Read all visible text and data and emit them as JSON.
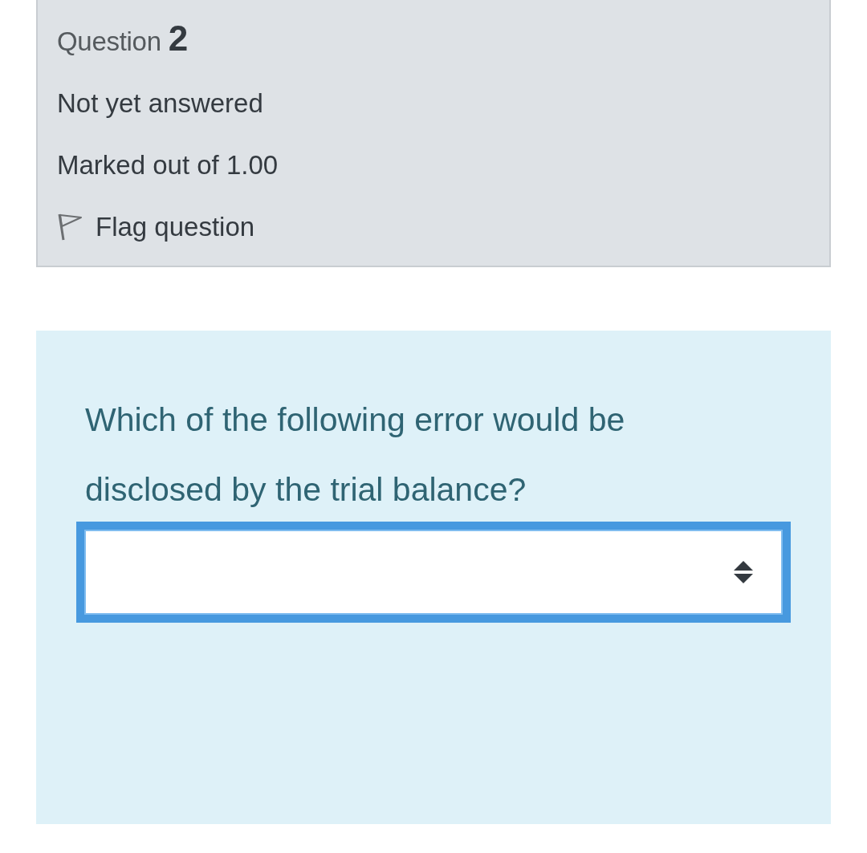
{
  "question_info": {
    "label": "Question",
    "number": "2",
    "state": "Not yet answered",
    "grade": "Marked out of 1.00",
    "flag": {
      "label": "Flag question",
      "flagged": false
    }
  },
  "formulation": {
    "text": "Which of the following error would be disclosed by the trial balance?",
    "select": {
      "focused": true
    }
  }
}
